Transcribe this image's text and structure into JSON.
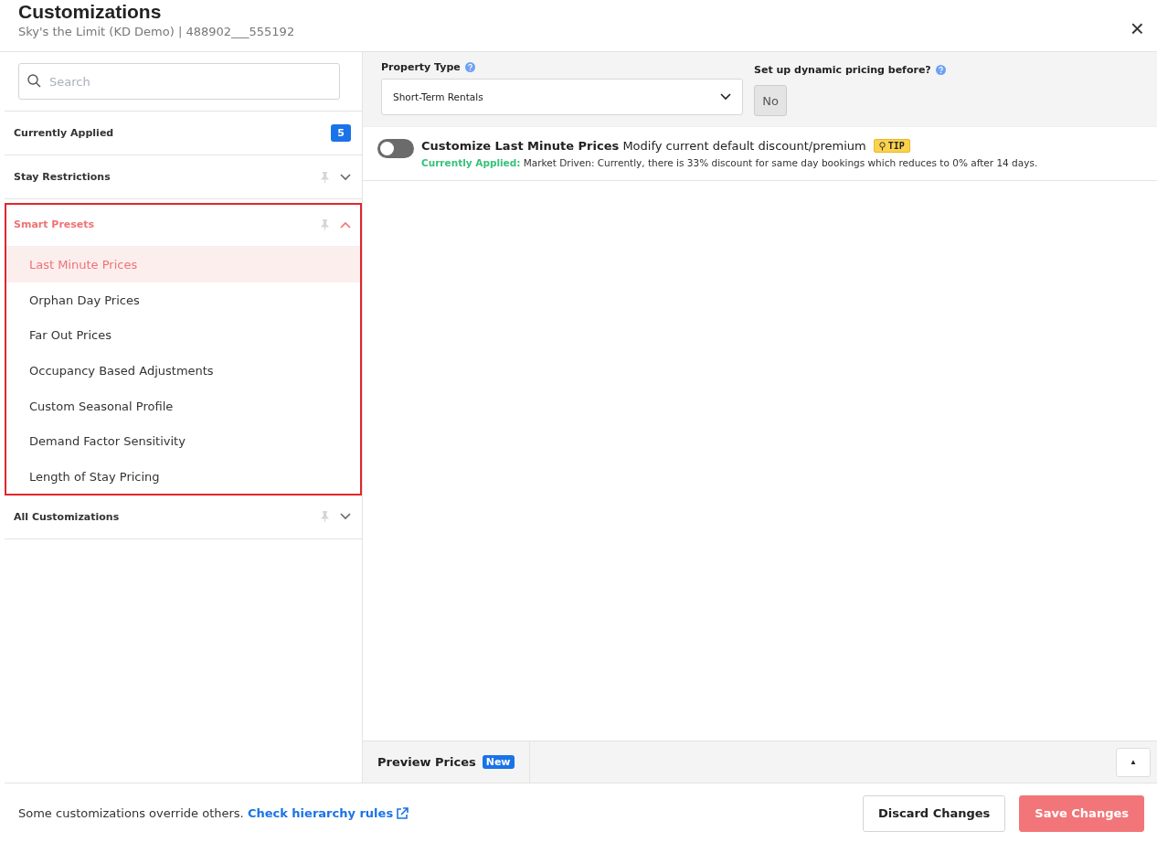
{
  "header": {
    "title": "Customizations",
    "subtitle": "Sky's the Limit (KD Demo) | 488902___555192",
    "close": "×"
  },
  "sidebar": {
    "search": {
      "placeholder": "Search"
    },
    "sections": [
      {
        "kind": "count",
        "label": "Currently Applied",
        "badge": "5",
        "expanded": false,
        "highlighted": false
      },
      {
        "kind": "collapsible",
        "label": "Stay Restrictions",
        "expanded": false,
        "highlighted": false
      },
      {
        "kind": "collapsible",
        "label": "Smart Presets",
        "expanded": true,
        "highlighted": true,
        "items": [
          {
            "label": "Last Minute Prices",
            "selected": true
          },
          {
            "label": "Orphan Day Prices",
            "selected": false
          },
          {
            "label": "Far Out Prices",
            "selected": false
          },
          {
            "label": "Occupancy Based Adjustments",
            "selected": false
          },
          {
            "label": "Custom Seasonal Profile",
            "selected": false
          },
          {
            "label": "Demand Factor Sensitivity",
            "selected": false
          },
          {
            "label": "Length of Stay Pricing",
            "selected": false
          }
        ]
      },
      {
        "kind": "collapsible",
        "label": "All Customizations",
        "expanded": false,
        "highlighted": false
      }
    ]
  },
  "settings": {
    "property_type": {
      "label": "Property Type",
      "value": "Short-Term Rentals"
    },
    "dynamic_pricing": {
      "label": "Set up dynamic pricing before?",
      "value": "No"
    }
  },
  "customization": {
    "on": false,
    "title": "Customize Last Minute Prices",
    "description": "Modify current default discount/premium",
    "tip": "TIP",
    "applied_label": "Currently Applied:",
    "applied_text": "Market Driven: Currently, there is 33% discount for same day bookings which reduces to 0% after 14 days."
  },
  "preview": {
    "label": "Preview Prices",
    "badge": "New",
    "toggle": "▲"
  },
  "footer": {
    "note": "Some customizations override others.",
    "link": "Check hierarchy rules",
    "buttons": [
      {
        "kind": "secondary",
        "label": "Discard Changes"
      },
      {
        "kind": "primary",
        "label": "Save Changes"
      }
    ]
  }
}
